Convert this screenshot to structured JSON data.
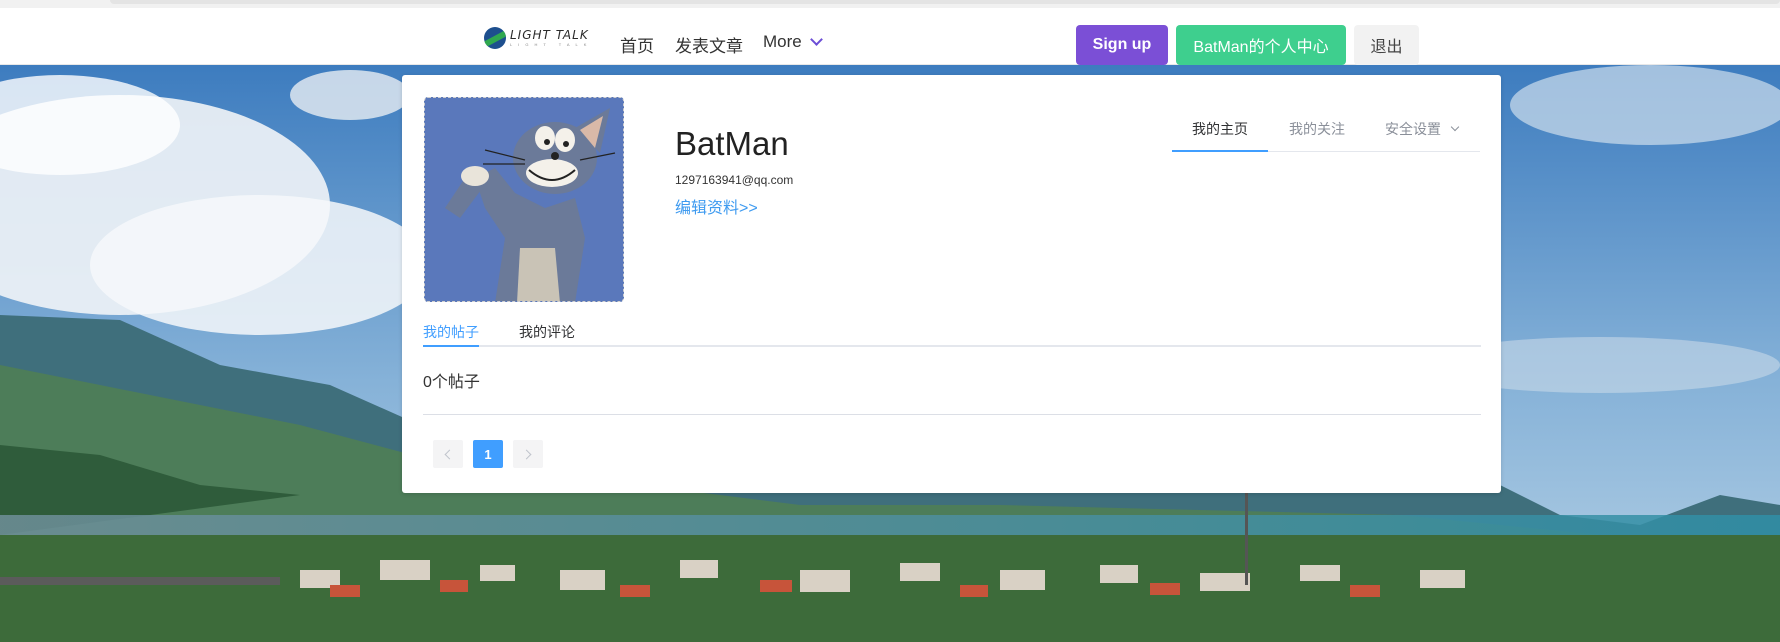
{
  "nav": {
    "logo_text": "LIGHT TALK",
    "logo_subtext": "LIGHT TALK",
    "home": "首页",
    "publish": "发表文章",
    "more": "More",
    "signup": "Sign up",
    "user_center": "BatMan的个人中心",
    "logout": "退出"
  },
  "profile": {
    "username": "BatMan",
    "email": "1297163941@qq.com",
    "edit_link": "编辑资料>>"
  },
  "right_tabs": [
    {
      "label": "我的主页",
      "active": true
    },
    {
      "label": "我的关注",
      "active": false
    },
    {
      "label": "安全设置",
      "active": false
    }
  ],
  "content_tabs": [
    {
      "label": "我的帖子",
      "active": true
    },
    {
      "label": "我的评论",
      "active": false
    }
  ],
  "post_count_text": "0个帖子",
  "pagination": {
    "current_page": "1"
  },
  "colors": {
    "signup": "#7b4fd6",
    "user_center": "#3ecf8e",
    "accent": "#409eff"
  }
}
